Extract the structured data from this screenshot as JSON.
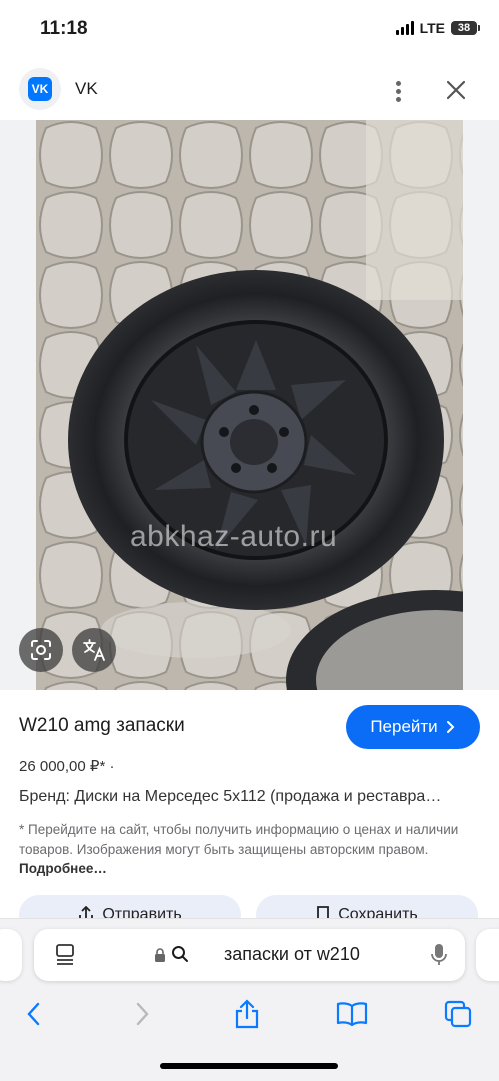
{
  "status_bar": {
    "time": "11:18",
    "network": "LTE",
    "battery": "38"
  },
  "header": {
    "app_name": "VK",
    "logo_text": "VK"
  },
  "image": {
    "watermark": "abkhaz-auto.ru"
  },
  "product": {
    "title": "W210 amg запаски",
    "go_button": "Перейти",
    "price": "26 000,00 ₽* ·",
    "brand": "Бренд: Диски на Мерседес 5x112 (продажа и реставра…",
    "note": "* Перейдите на сайт, чтобы получить информацию о ценах и наличии товаров. Изображения могут быть защищены авторским правом.",
    "more_link": "Подробнее…"
  },
  "actions": {
    "send": "Отправить",
    "save": "Сохранить"
  },
  "browser": {
    "query": "запаски от w210"
  },
  "colors": {
    "accent": "#0b6cf5",
    "vk_brand": "#0077ff"
  }
}
